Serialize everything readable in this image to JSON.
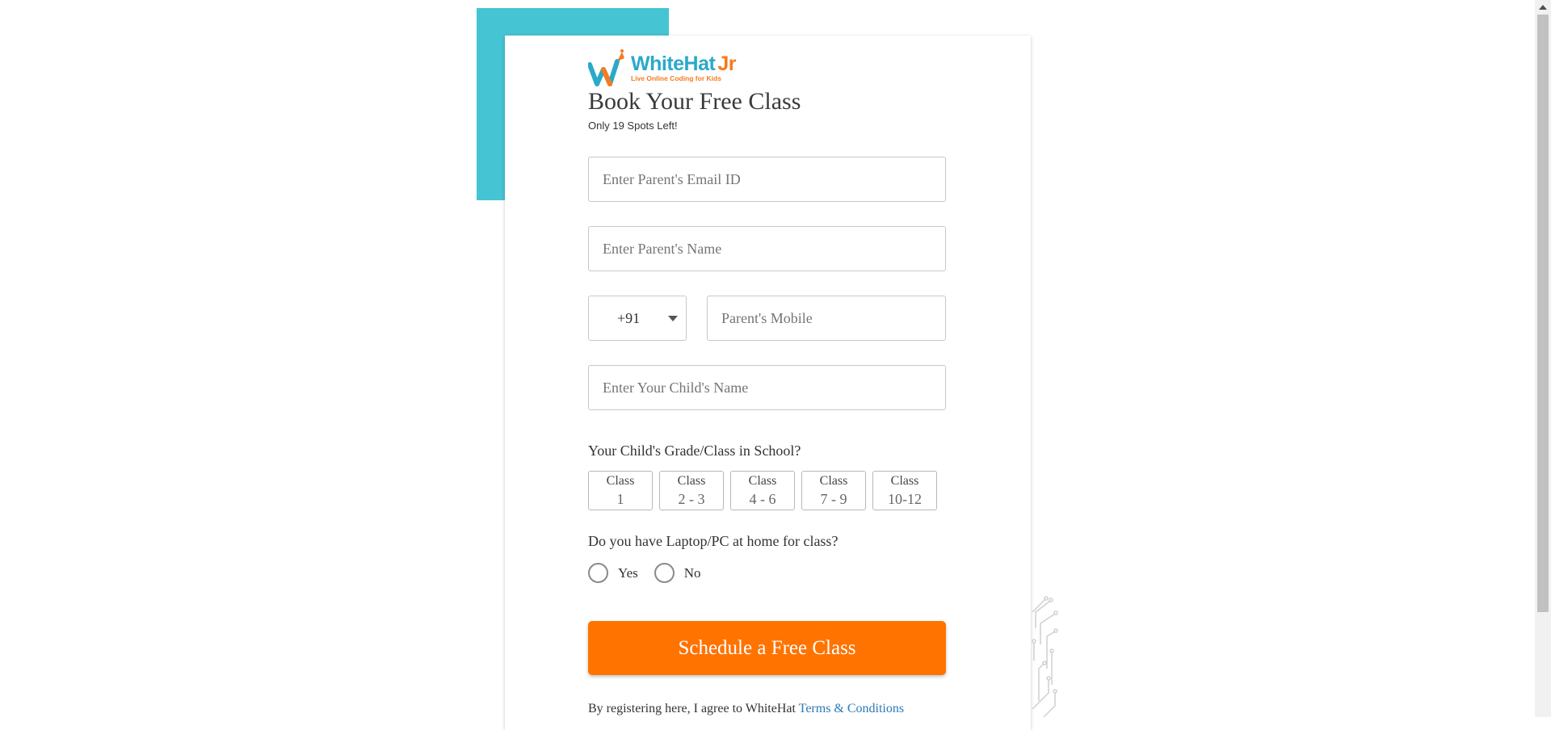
{
  "brand": {
    "name": "WhiteHat",
    "name_suffix": "Jr",
    "tagline": "Live Online Coding for Kids",
    "colors": {
      "teal": "#45c4d3",
      "orange": "#ff7300",
      "logo_blue": "#2aa9c9"
    }
  },
  "form": {
    "title": "Book Your Free Class",
    "subtitle": "Only 19 Spots Left!",
    "email_placeholder": "Enter Parent's Email ID",
    "parent_name_placeholder": "Enter Parent's Name",
    "country_code": "+91",
    "mobile_placeholder": "Parent's Mobile",
    "child_name_placeholder": "Enter Your Child's Name",
    "grade_label": "Your Child's Grade/Class in School?",
    "grades": [
      {
        "top": "Class",
        "bottom": "1"
      },
      {
        "top": "Class",
        "bottom": "2 - 3"
      },
      {
        "top": "Class",
        "bottom": "4 - 6"
      },
      {
        "top": "Class",
        "bottom": "7 - 9"
      },
      {
        "top": "Class",
        "bottom": "10-12"
      }
    ],
    "laptop_label": "Do you have Laptop/PC at home for class?",
    "laptop_options": [
      "Yes",
      "No"
    ],
    "submit_label": "Schedule a Free Class",
    "terms_prefix": "By registering here, I agree to WhiteHat",
    "terms_link": "Terms & Conditions"
  },
  "icons": {
    "logo": "whitehat-w-rocket-icon",
    "dropdown": "chevron-down-icon",
    "decoration": "circuit-pattern"
  }
}
